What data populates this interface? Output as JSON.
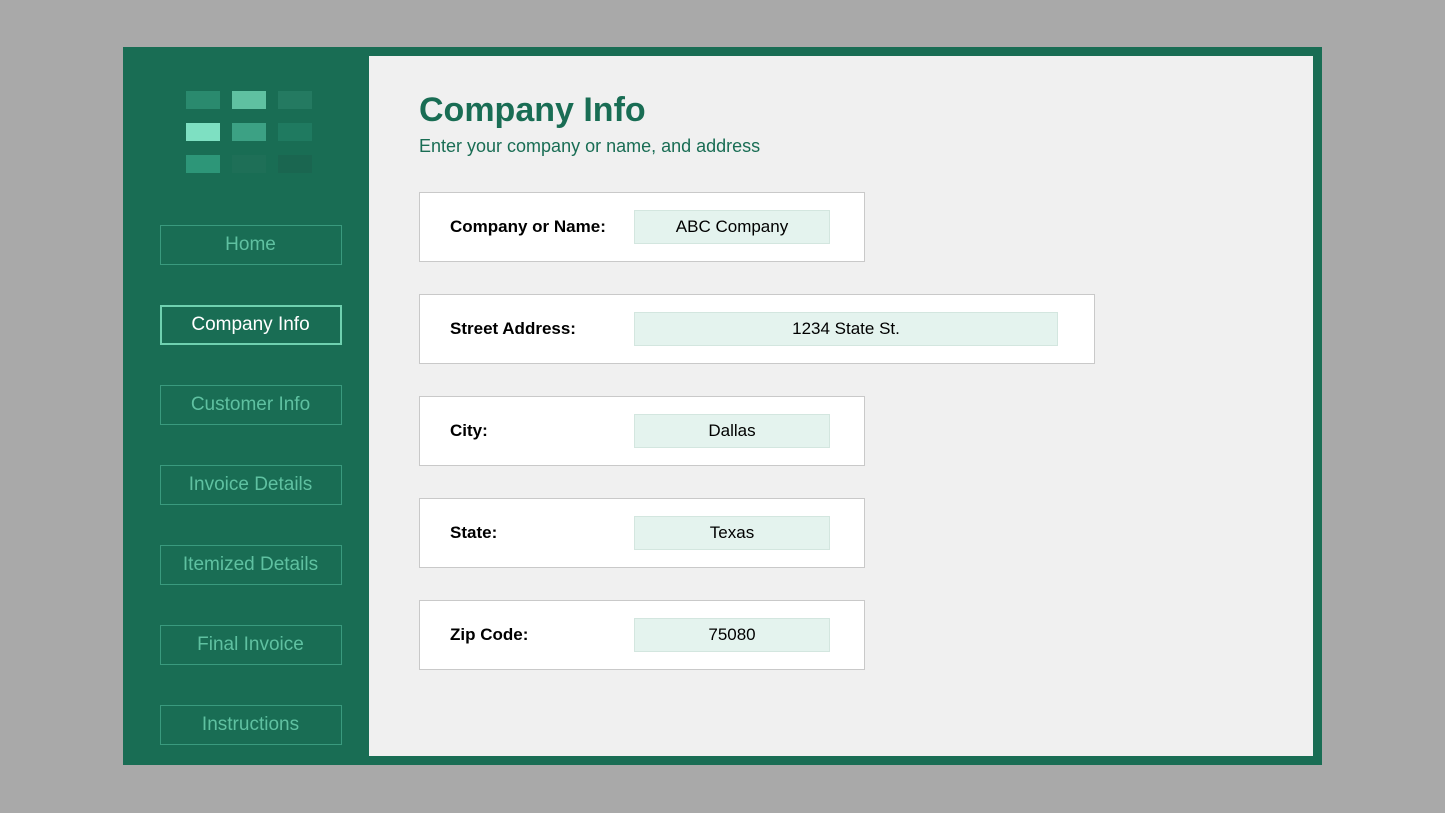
{
  "sidebar": {
    "items": [
      {
        "label": "Home",
        "active": false
      },
      {
        "label": "Company Info",
        "active": true
      },
      {
        "label": "Customer Info",
        "active": false
      },
      {
        "label": "Invoice Details",
        "active": false
      },
      {
        "label": "Itemized Details",
        "active": false
      },
      {
        "label": "Final Invoice",
        "active": false
      },
      {
        "label": "Instructions",
        "active": false
      }
    ]
  },
  "main": {
    "title": "Company Info",
    "subtitle": "Enter your company or name, and address",
    "fields": {
      "company_label": "Company or Name:",
      "company_value": "ABC Company",
      "street_label": "Street Address:",
      "street_value": "1234 State St.",
      "city_label": "City:",
      "city_value": "Dallas",
      "state_label": "State:",
      "state_value": "Texas",
      "zip_label": "Zip Code:",
      "zip_value": "75080"
    }
  }
}
